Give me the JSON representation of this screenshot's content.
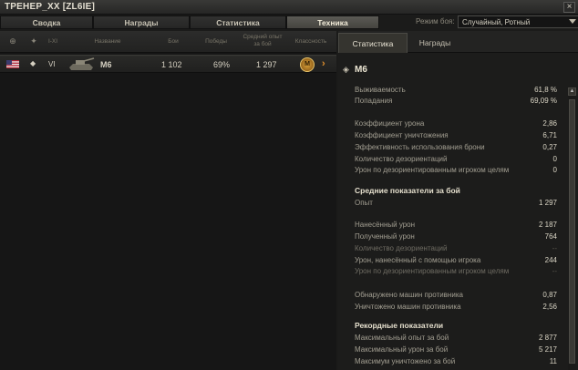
{
  "window": {
    "title": "ТРЕНЕР_XX [ZL6IE]",
    "close_label": "×"
  },
  "tabs": [
    "Сводка",
    "Награды",
    "Статистика",
    "Техника"
  ],
  "battle_mode": {
    "label": "Режим боя:",
    "value": "Случайный, Ротный"
  },
  "columns": {
    "tier": "I-XI",
    "name": "Название",
    "battles": "Бои",
    "wins": "Победы",
    "avg_xp": "Средний опыт за бой",
    "mastery": "Классность"
  },
  "vehicle_row": {
    "tier": "VI",
    "name": "M6",
    "battles": "1 102",
    "wins": "69%",
    "avg_xp": "1 297",
    "mastery": "M",
    "chevron": "›"
  },
  "right_tabs": [
    "Статистика",
    "Награды"
  ],
  "details": {
    "vehicle_name": "M6",
    "group1": [
      {
        "label": "Выживаемость",
        "value": "61,8 %"
      },
      {
        "label": "Попадания",
        "value": "69,09 %"
      }
    ],
    "group2": [
      {
        "label": "Коэффициент урона",
        "value": "2,86"
      },
      {
        "label": "Коэффициент уничтожения",
        "value": "6,71"
      },
      {
        "label": "Эффективность использования брони",
        "value": "0,27"
      },
      {
        "label": "Количество дезориентаций",
        "value": "0"
      },
      {
        "label": "Урон по дезориентированным игроком целям",
        "value": "0"
      }
    ],
    "section_avg": "Средние показатели за бой",
    "avg_xp": {
      "label": "Опыт",
      "value": "1 297"
    },
    "group3": [
      {
        "label": "Нанесённый урон",
        "value": "2 187"
      },
      {
        "label": "Полученный урон",
        "value": "764"
      },
      {
        "label": "Количество дезориентаций",
        "value": "--"
      },
      {
        "label": "Урон, нанесённый с помощью игрока",
        "value": "244"
      },
      {
        "label": "Урон по дезориентированным игроком целям",
        "value": "--"
      }
    ],
    "group4": [
      {
        "label": "Обнаружено машин противника",
        "value": "0,87"
      },
      {
        "label": "Уничтожено машин противника",
        "value": "2,56"
      }
    ],
    "section_records": "Рекордные показатели",
    "records": [
      {
        "label": "Максимальный опыт за бой",
        "value": "2 877"
      },
      {
        "label": "Максимальный урон за бой",
        "value": "5 217"
      },
      {
        "label": "Максимум уничтожено за бой",
        "value": "11"
      }
    ]
  }
}
